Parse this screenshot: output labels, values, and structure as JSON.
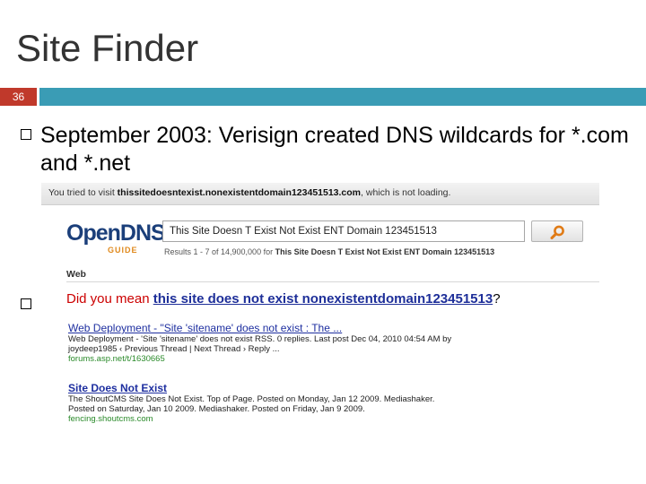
{
  "slide": {
    "title": "Site Finder",
    "number": "36",
    "bullets": [
      {
        "text": "September 2003: Verisign created DNS wildcards for *.com and *.net"
      },
      {
        "text": ""
      }
    ],
    "colors": {
      "number_band": "#c0392b",
      "title_band": "#3a9cb5"
    }
  },
  "screenshot": {
    "notice_prefix": "You tried to visit",
    "notice_domain": "thissitedoesntexist.nonexistentdomain123451513.com",
    "notice_suffix": ", which is not loading.",
    "logo_main": "OpenDNS",
    "logo_sub": "GUIDE",
    "search": {
      "value": "This Site Doesn T Exist Not Exist ENT Domain 123451513",
      "button_icon": "search-icon"
    },
    "results_count_prefix": "Results 1 - 7 of 14,900,000 for",
    "results_count_query": "This Site Doesn T Exist Not Exist ENT Domain 123451513",
    "section_label": "Web",
    "did_you_mean": {
      "prefix": "Did you mean",
      "link": "this site does not exist nonexistentdomain123451513",
      "suffix": "?"
    },
    "results": [
      {
        "title": "Web Deployment - \"Site 'sitename' does not exist : The ...",
        "snippet1": "Web Deployment - 'Site 'sitename' does not exist RSS. 0 replies. Last post Dec 04, 2010 04:54 AM by",
        "snippet2": "joydeep1985 ‹ Previous Thread | Next Thread › Reply ...",
        "url": "forums.asp.net/t/1630665"
      },
      {
        "title": "Site Does Not Exist",
        "snippet1": "The ShoutCMS Site Does Not Exist. Top of Page. Posted on Monday, Jan 12 2009. Mediashaker.",
        "snippet2": "Posted on Saturday, Jan 10 2009. Mediashaker. Posted on Friday, Jan 9 2009.",
        "url": "fencing.shoutcms.com"
      }
    ]
  }
}
